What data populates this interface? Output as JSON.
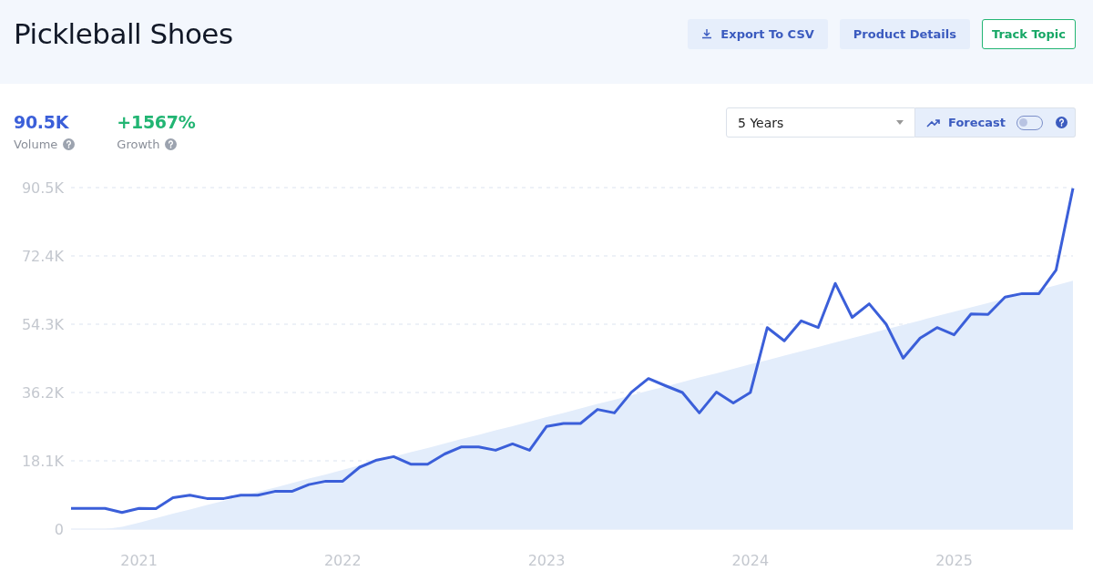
{
  "header": {
    "title": "Pickleball Shoes",
    "buttons": [
      {
        "label": "Export To CSV",
        "kind": "download"
      },
      {
        "label": "Product Details",
        "kind": "plain"
      },
      {
        "label": "Track Topic",
        "kind": "outline"
      }
    ]
  },
  "stats": [
    {
      "value": "90.5K",
      "label": "Volume",
      "color": "#3b5fd9"
    },
    {
      "value": "+1567%",
      "label": "Growth",
      "color": "#22b573"
    }
  ],
  "controls": {
    "range": "5 Years",
    "forecast": {
      "label": "Forecast",
      "on": false
    }
  },
  "chart_data": {
    "type": "line",
    "grid": true,
    "categories": [
      null,
      null,
      null,
      null,
      "2021",
      null,
      null,
      null,
      null,
      null,
      null,
      null,
      null,
      null,
      null,
      null,
      "2022",
      null,
      null,
      null,
      null,
      null,
      null,
      null,
      null,
      null,
      null,
      null,
      "2023",
      null,
      null,
      null,
      null,
      null,
      null,
      null,
      null,
      null,
      null,
      null,
      "2024",
      null,
      null,
      null,
      null,
      null,
      null,
      null,
      null,
      null,
      null,
      null,
      "2025",
      null,
      null,
      null,
      null,
      null,
      null,
      null
    ],
    "series": [
      {
        "type": "line",
        "color": "#3b5fd9",
        "values": [
          5.5,
          5.5,
          5.5,
          4.4,
          5.5,
          5.4,
          8.3,
          9.0,
          8.1,
          8.1,
          9.0,
          9.0,
          10.0,
          10.0,
          11.8,
          12.7,
          12.7,
          16.4,
          18.3,
          19.2,
          17.2,
          17.2,
          19.9,
          21.8,
          21.8,
          20.9,
          22.6,
          20.9,
          27.2,
          28.0,
          28.0,
          31.7,
          30.8,
          36.3,
          39.9,
          38.0,
          36.2,
          30.8,
          36.3,
          33.4,
          36.2,
          53.4,
          49.9,
          55.2,
          53.4,
          65.1,
          56.1,
          59.7,
          54.3,
          45.3,
          50.6,
          53.4,
          51.5,
          57.0,
          56.9,
          61.5,
          62.4,
          62.4,
          68.6,
          90.3
        ]
      },
      {
        "type": "area",
        "color": "#e3edfb",
        "values": [
          0,
          0,
          0,
          0.6,
          1.7,
          2.9,
          4.1,
          5.2,
          6.4,
          7.5,
          8.7,
          9.9,
          11.0,
          12.2,
          13.4,
          14.5,
          15.7,
          16.9,
          18.0,
          19.2,
          20.4,
          21.5,
          22.7,
          23.9,
          25.0,
          26.2,
          27.3,
          28.5,
          29.7,
          30.8,
          32.0,
          33.2,
          34.3,
          35.5,
          36.7,
          37.8,
          39.0,
          40.2,
          41.3,
          42.5,
          43.7,
          44.8,
          46.0,
          47.1,
          48.3,
          49.5,
          50.6,
          51.8,
          53.0,
          54.1,
          55.3,
          56.5,
          57.6,
          58.8,
          59.9,
          61.1,
          62.3,
          63.4,
          64.6,
          65.8
        ]
      }
    ],
    "ylim": [
      0,
      90.5
    ],
    "yticks": [
      {
        "value": 0,
        "label": "0"
      },
      {
        "value": 18.1,
        "label": "18.1K"
      },
      {
        "value": 36.2,
        "label": "36.2K"
      },
      {
        "value": 54.3,
        "label": "54.3K"
      },
      {
        "value": 72.4,
        "label": "72.4K"
      },
      {
        "value": 90.5,
        "label": "90.5K"
      }
    ]
  }
}
